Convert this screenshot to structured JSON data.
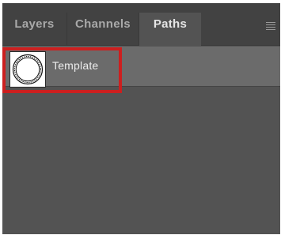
{
  "panel": {
    "tabs": [
      {
        "label": "Layers",
        "active": false
      },
      {
        "label": "Channels",
        "active": false
      },
      {
        "label": "Paths",
        "active": true
      }
    ],
    "menu_icon": "hamburger-menu-icon"
  },
  "paths": {
    "items": [
      {
        "name": "Template",
        "thumbnail_icon": "circle-path-icon",
        "highlighted": true
      }
    ]
  },
  "colors": {
    "panel_bg": "#535353",
    "tabbar_bg": "#424242",
    "selected_row": "#6b6b6b",
    "highlight": "#cc1f1f"
  }
}
